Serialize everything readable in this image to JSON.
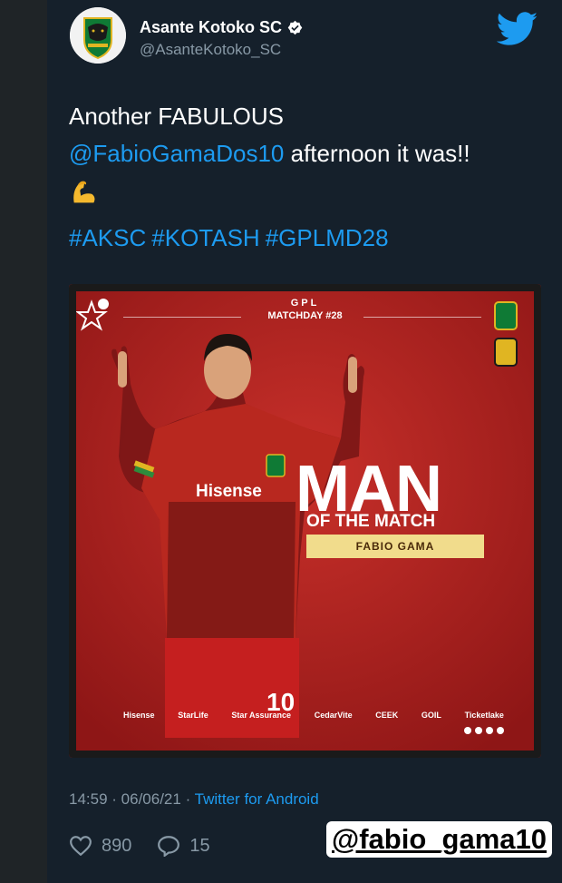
{
  "account": {
    "name": "Asante Kotoko SC",
    "handle": "@AsanteKotoko_SC"
  },
  "tweet": {
    "line1": "Another FABULOUS",
    "mention": "@FabioGamaDos10",
    "line2_rest": " afternoon it was!!",
    "emoji": "flexed-biceps-icon",
    "hashtags": [
      "#AKSC",
      "#KOTASH",
      "#GPLMD28"
    ]
  },
  "poster": {
    "league": "GPL",
    "matchday": "MATCHDAY #28",
    "title_big": "MAN",
    "title_small": "OF THE MATCH",
    "player": "FABIO GAMA",
    "shirt_sponsor": "Hisense",
    "shirt_number": "10",
    "sponsors": [
      "Hisense",
      "StarLife",
      "Star Assurance",
      "CedarVite",
      "CEEK",
      "GOIL",
      "Ticketlake"
    ]
  },
  "meta": {
    "time": "14:59",
    "date": "06/06/21",
    "separator": " · ",
    "source": "Twitter for Android"
  },
  "actions": {
    "likes": "890",
    "replies": "15"
  },
  "watermark": "@fabio_gama10",
  "colors": {
    "background": "#15202b",
    "accent": "#1d9bf0",
    "muted": "#8899a6",
    "poster_red": "#b22222"
  }
}
